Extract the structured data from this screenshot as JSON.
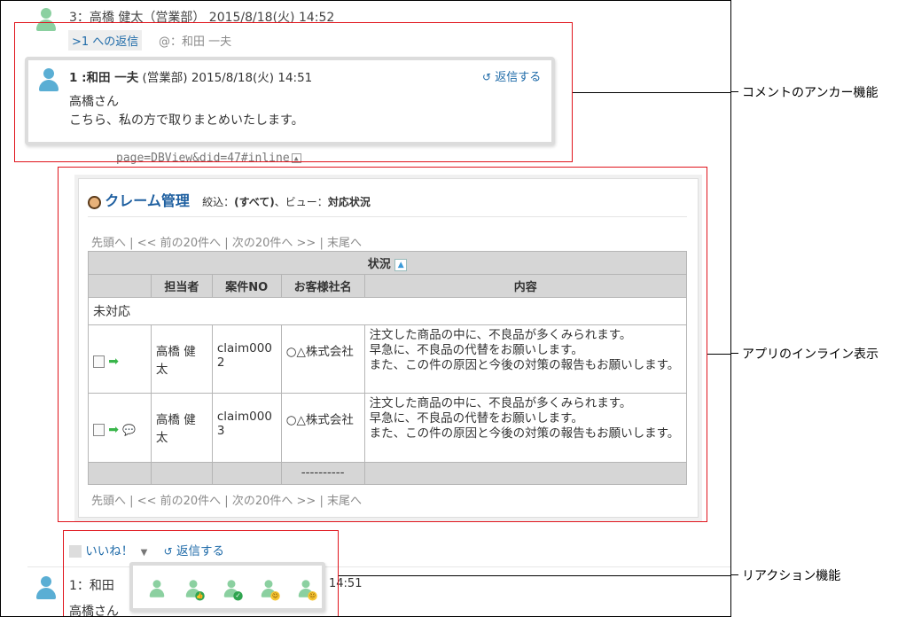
{
  "comment3": {
    "header": "3：高橋 健太（営業部） 2015/8/18(火) 14:52",
    "reply_chip": ">1 への返信",
    "mention": "@：和田 一夫"
  },
  "popup": {
    "author": "1 :和田 一夫",
    "dept_time": "(営業部) 2015/8/18(火) 14:51",
    "reply": "返信する",
    "line1": "高橋さん",
    "line2": "こちら、私の方で取りまとめいたします。"
  },
  "url_fragment": "page=DBView&did=47#inline",
  "inline_app": {
    "title": "クレーム管理",
    "filter_label": "絞込：",
    "filter_value": "(すべて)",
    "view_label": "、ビュー：",
    "view_value": "対応状況",
    "pager": {
      "first": "先頭へ",
      "prev": "<< 前の20件へ",
      "next": "次の20件へ >>",
      "last": "末尾へ",
      "sep": "|"
    },
    "table": {
      "group_header": "状況",
      "columns": [
        "担当者",
        "案件NO",
        "お客様社名",
        "内容"
      ],
      "group_label": "未対応",
      "rows": [
        {
          "assignee": "高橋 健太",
          "case_no": "claim0002",
          "customer": "○△株式会社",
          "content": "注文した商品の中に、不良品が多くみられます。\n早急に、不良品の代替をお願いします。\nまた、この件の原因と今後の対策の報告もお願いします。"
        },
        {
          "assignee": "高橋 健太",
          "case_no": "claim0003",
          "customer": "○△株式会社",
          "content": "注文した商品の中に、不良品が多くみられます。\n早急に、不良品の代替をお願いします。\nまた、この件の原因と今後の対策の報告もお願いします。"
        }
      ],
      "footer_value": "----------"
    }
  },
  "actions": {
    "like": "いいね！",
    "reply": "返信する"
  },
  "comment1_bottom": {
    "header_prefix": "1：和田",
    "time_tail": "14:51",
    "body": "高橋さん"
  },
  "callouts": {
    "anchor": "コメントのアンカー機能",
    "inline": "アプリのインライン表示",
    "reaction": "リアクション機能"
  },
  "colors": {
    "link": "#1e6aa8",
    "callout_box": "#e0141c",
    "avatar_green": "#8bd0a0",
    "avatar_blue": "#5aaed4"
  }
}
